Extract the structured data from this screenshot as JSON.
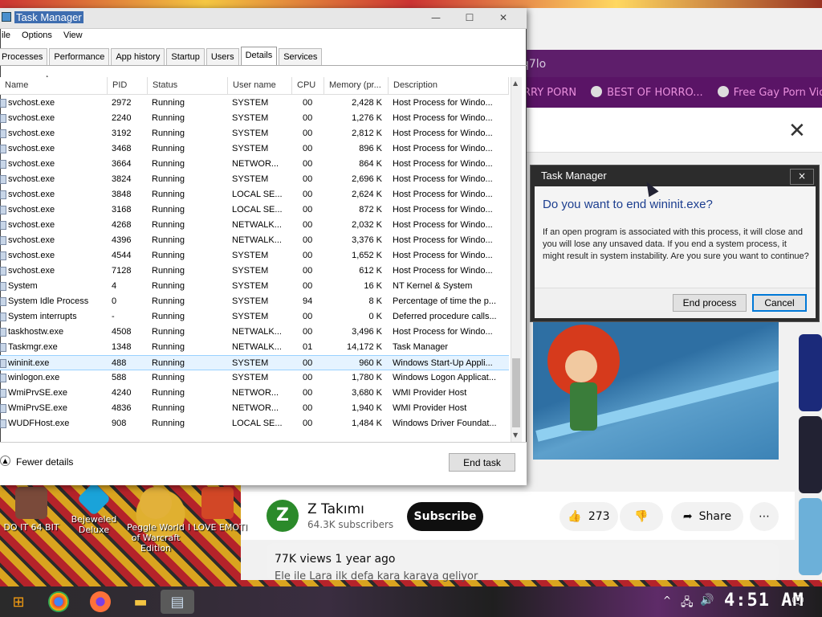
{
  "task_manager": {
    "title": "Task Manager",
    "menu": [
      "ile",
      "Options",
      "View"
    ],
    "tabs": [
      "Processes",
      "Performance",
      "App history",
      "Startup",
      "Users",
      "Details",
      "Services"
    ],
    "active_tab": "Details",
    "columns": [
      "Name",
      "PID",
      "Status",
      "User name",
      "CPU",
      "Memory (pr...",
      "Description"
    ],
    "rows": [
      [
        "svchost.exe",
        "2972",
        "Running",
        "SYSTEM",
        "00",
        "2,428 K",
        "Host Process for Windo..."
      ],
      [
        "svchost.exe",
        "2240",
        "Running",
        "SYSTEM",
        "00",
        "1,276 K",
        "Host Process for Windo..."
      ],
      [
        "svchost.exe",
        "3192",
        "Running",
        "SYSTEM",
        "00",
        "2,812 K",
        "Host Process for Windo..."
      ],
      [
        "svchost.exe",
        "3468",
        "Running",
        "SYSTEM",
        "00",
        "896 K",
        "Host Process for Windo..."
      ],
      [
        "svchost.exe",
        "3664",
        "Running",
        "NETWOR...",
        "00",
        "864 K",
        "Host Process for Windo..."
      ],
      [
        "svchost.exe",
        "3824",
        "Running",
        "SYSTEM",
        "00",
        "2,696 K",
        "Host Process for Windo..."
      ],
      [
        "svchost.exe",
        "3848",
        "Running",
        "LOCAL SE...",
        "00",
        "2,624 K",
        "Host Process for Windo..."
      ],
      [
        "svchost.exe",
        "3168",
        "Running",
        "LOCAL SE...",
        "00",
        "872 K",
        "Host Process for Windo..."
      ],
      [
        "svchost.exe",
        "4268",
        "Running",
        "NETWALK...",
        "00",
        "2,032 K",
        "Host Process for Windo..."
      ],
      [
        "svchost.exe",
        "4396",
        "Running",
        "NETWALK...",
        "00",
        "3,376 K",
        "Host Process for Windo..."
      ],
      [
        "svchost.exe",
        "4544",
        "Running",
        "SYSTEM",
        "00",
        "1,652 K",
        "Host Process for Windo..."
      ],
      [
        "svchost.exe",
        "7128",
        "Running",
        "SYSTEM",
        "00",
        "612 K",
        "Host Process for Windo..."
      ],
      [
        "System",
        "4",
        "Running",
        "SYSTEM",
        "00",
        "16 K",
        "NT Kernel & System"
      ],
      [
        "System Idle Process",
        "0",
        "Running",
        "SYSTEM",
        "94",
        "8 K",
        "Percentage of time the p..."
      ],
      [
        "System interrupts",
        "-",
        "Running",
        "SYSTEM",
        "00",
        "0 K",
        "Deferred procedure calls..."
      ],
      [
        "taskhostw.exe",
        "4508",
        "Running",
        "NETWALK...",
        "00",
        "3,496 K",
        "Host Process for Windo..."
      ],
      [
        "Taskmgr.exe",
        "1348",
        "Running",
        "NETWALK...",
        "01",
        "14,172 K",
        "Task Manager"
      ],
      [
        "wininit.exe",
        "488",
        "Running",
        "SYSTEM",
        "00",
        "960 K",
        "Windows Start-Up Appli..."
      ],
      [
        "winlogon.exe",
        "588",
        "Running",
        "SYSTEM",
        "00",
        "1,780 K",
        "Windows Logon Applicat..."
      ],
      [
        "WmiPrvSE.exe",
        "4240",
        "Running",
        "NETWOR...",
        "00",
        "3,680 K",
        "WMI Provider Host"
      ],
      [
        "WmiPrvSE.exe",
        "4836",
        "Running",
        "NETWOR...",
        "00",
        "1,940 K",
        "WMI Provider Host"
      ],
      [
        "WUDFHost.exe",
        "908",
        "Running",
        "LOCAL SE...",
        "00",
        "1,484 K",
        "Windows Driver Foundat..."
      ]
    ],
    "selected_row": 17,
    "fewer_details": "Fewer details",
    "end_task": "End task"
  },
  "dialog": {
    "title": "Task Manager",
    "question": "Do you want to end wininit.exe?",
    "message": "If an open program is associated with this process, it will close and you will lose any unsaved data. If you end a system process, it might result in system instability. Are you sure you want to continue?",
    "end_button": "End process",
    "cancel_button": "Cancel",
    "close": "×"
  },
  "browser": {
    "address_fragment": "q7lo",
    "bookmarks": [
      "RRY PORN",
      "BEST OF HORRO...",
      "Free Gay Porn Vid..."
    ],
    "close_symbol": "✕",
    "channel": {
      "avatar": "Z",
      "name": "Z Takımı",
      "subscribers": "64.3K subscribers",
      "subscribe": "Subscribe"
    },
    "likes": "273",
    "share": "Share",
    "more": "⋯",
    "views": "77K views  1 year ago",
    "description_line": "Ele ile Lara ilk defa kara karaya geliyor"
  },
  "desktop_icons": [
    {
      "label": "DO IT 64 BIT",
      "color": "#7a4a3a"
    },
    {
      "label": "Bejeweled Deluxe",
      "color": "#1aa3d9"
    },
    {
      "label": "Peggle World of Warcraft Edition",
      "color": "#e2b13a"
    },
    {
      "label": "I LOVE EMOTI",
      "color": "#d24726"
    }
  ],
  "taskbar": {
    "clock": "4:51 AM"
  },
  "colors": {
    "accent": "#0078d7",
    "selection": "#e5f3ff",
    "browser_purple": "#5a1466"
  }
}
